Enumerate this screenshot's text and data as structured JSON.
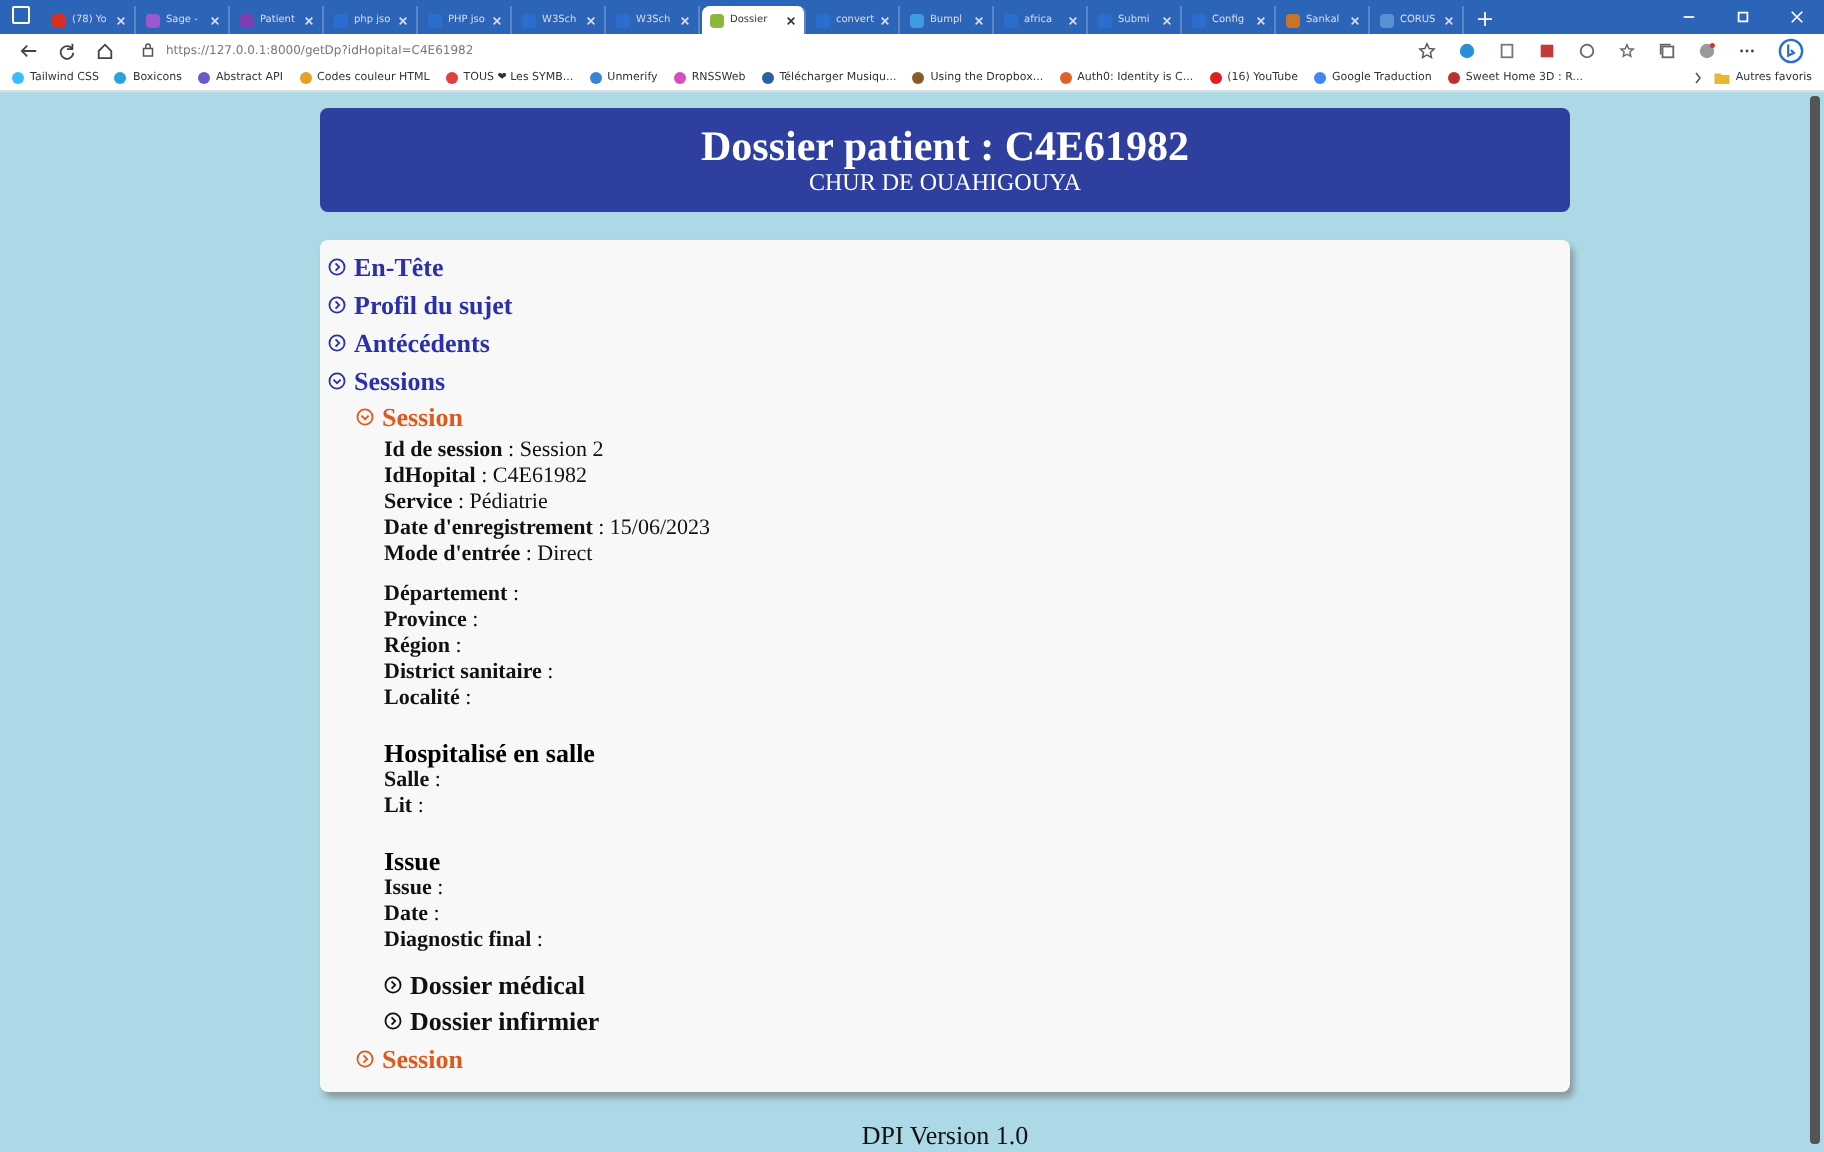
{
  "browser": {
    "tabs": [
      {
        "title": "(78) Yo",
        "selected": false,
        "color": "#d93025"
      },
      {
        "title": "Sage -",
        "selected": false,
        "color": "#9b59d0"
      },
      {
        "title": "Patient",
        "selected": false,
        "color": "#7b3fb0"
      },
      {
        "title": "php jso",
        "selected": false,
        "color": "#2a6fd0"
      },
      {
        "title": "PHP jso",
        "selected": false,
        "color": "#2a6fd0"
      },
      {
        "title": "W3Sch",
        "selected": false,
        "color": "#2a6fd0"
      },
      {
        "title": "W3Sch",
        "selected": false,
        "color": "#2a6fd0"
      },
      {
        "title": "Dossier",
        "selected": true,
        "color": "#8bb83a"
      },
      {
        "title": "convert",
        "selected": false,
        "color": "#2a6fd0"
      },
      {
        "title": "Bumpl",
        "selected": false,
        "color": "#3d9be0"
      },
      {
        "title": "africa",
        "selected": false,
        "color": "#2a6fd0"
      },
      {
        "title": "Submi",
        "selected": false,
        "color": "#2a6fd0"
      },
      {
        "title": "Config",
        "selected": false,
        "color": "#2a6fd0"
      },
      {
        "title": "Sankal",
        "selected": false,
        "color": "#c8742a"
      },
      {
        "title": "CORUS",
        "selected": false,
        "color": "#5a8fd0"
      }
    ],
    "url": "https://127.0.0.1:8000/getDp?idHopital=C4E61982",
    "bookmarks": [
      {
        "title": "Tailwind CSS",
        "color": "#38bdf8"
      },
      {
        "title": "Boxicons",
        "color": "#2aa3d8"
      },
      {
        "title": "Abstract API",
        "color": "#6a5acd"
      },
      {
        "title": "Codes couleur HTML",
        "color": "#e8a020"
      },
      {
        "title": "TOUS ❤ Les SYMB...",
        "color": "#e04040"
      },
      {
        "title": "Unmerify",
        "color": "#3b82d6"
      },
      {
        "title": "RNSSWeb",
        "color": "#d050c0"
      },
      {
        "title": "Télécharger Musiqu...",
        "color": "#2a5fa0"
      },
      {
        "title": "Using the Dropbox...",
        "color": "#8a5a2a"
      },
      {
        "title": "Auth0: Identity is C...",
        "color": "#e0602a"
      },
      {
        "title": "(16) YouTube",
        "color": "#e02020"
      },
      {
        "title": "Google Traduction",
        "color": "#4285f4"
      },
      {
        "title": "Sweet Home 3D : R...",
        "color": "#c03030"
      }
    ],
    "other_bookmarks": "Autres favoris"
  },
  "header": {
    "title": "Dossier patient : C4E61982",
    "subtitle": "CHUR DE OUAHIGOUYA"
  },
  "sections": [
    {
      "title": "En-Tête",
      "expanded": false
    },
    {
      "title": "Profil du sujet",
      "expanded": false
    },
    {
      "title": "Antécédents",
      "expanded": false
    },
    {
      "title": "Sessions",
      "expanded": true,
      "children": [
        {
          "title": "Session",
          "expanded": true,
          "groups": [
            {
              "fields": [
                "**Id de session** : Session 2",
                "**IdHopital** : C4E61982",
                "**Service** : Pédiatrie",
                "**Date d'enregistrement** : 15/06/2023",
                "**Mode d'entrée** : Direct"
              ]
            },
            {
              "fields": [
                "**Département** :",
                "**Province** :",
                "**Région** :",
                "**District sanitaire** :",
                "**Localité** :"
              ]
            },
            {
              "heading": "Hospitalisé en salle",
              "fields": [
                "**Salle** :",
                "**Lit** :"
              ]
            },
            {
              "heading": "Issue",
              "fields": [
                "**Issue** :",
                "**Date** :",
                "**Diagnostic final** :"
              ]
            }
          ],
          "children": [
            {
              "title": "Dossier médical",
              "expanded": false
            },
            {
              "title": "Dossier infirmier",
              "expanded": false
            }
          ]
        },
        {
          "title": "Session",
          "expanded": false
        }
      ]
    }
  ],
  "footer": "DPI Version 1.0"
}
